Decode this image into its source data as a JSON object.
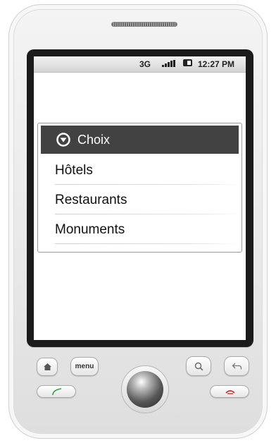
{
  "status_bar": {
    "network": "3G",
    "time": "12:27 PM",
    "icons": [
      "signal-icon",
      "battery-icon"
    ]
  },
  "dialog": {
    "title": "Choix",
    "header_icon": "dropdown-circle-icon",
    "items": [
      {
        "label": "Hôtels"
      },
      {
        "label": "Restaurants"
      },
      {
        "label": "Monuments"
      }
    ]
  },
  "device": {
    "menu_label": "menu",
    "buttons": [
      "home-icon",
      "search-icon",
      "back-icon",
      "call-icon",
      "end-call-icon"
    ]
  },
  "colors": {
    "header_bg": "#424242",
    "call_green": "#2e9e3a",
    "end_red": "#c62828"
  }
}
